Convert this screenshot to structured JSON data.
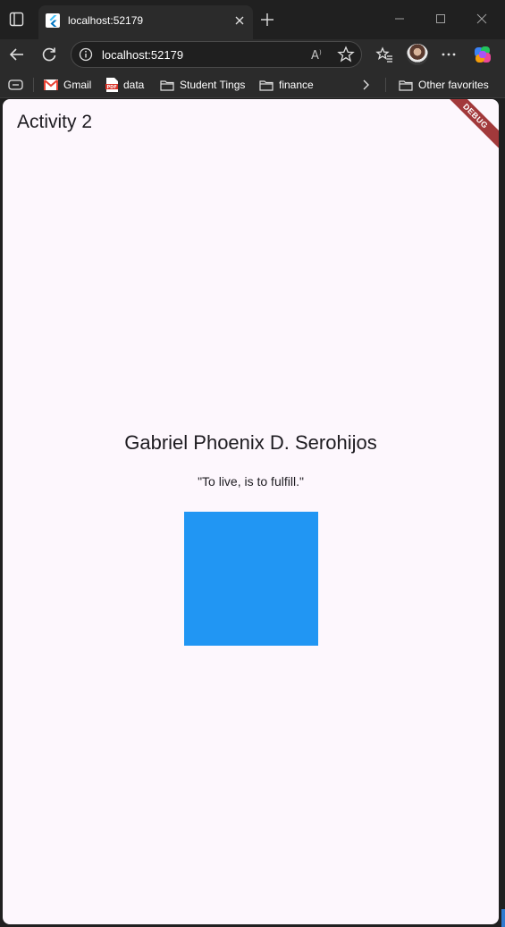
{
  "browser": {
    "tab": {
      "title": "localhost:52179"
    },
    "address": {
      "url": "localhost:52179"
    },
    "bookmarks": [
      {
        "label": "Gmail",
        "icon": "gmail-icon"
      },
      {
        "label": "data",
        "icon": "pdf-icon"
      },
      {
        "label": "Student Tings",
        "icon": "folder-icon"
      },
      {
        "label": "finance",
        "icon": "folder-icon"
      }
    ],
    "other_favorites": "Other favorites"
  },
  "app": {
    "appbar_title": "Activity 2",
    "debug_banner": "DEBUG",
    "name": "Gabriel Phoenix D. Serohijos",
    "quote": "\"To live, is to fulfill.\"",
    "square_color": "#2196f3"
  },
  "colors": {
    "page_background": "#fdf7fd",
    "chrome_background": "#202020",
    "toolbar_background": "#2b2b2b",
    "debug_banner": "#a2393b"
  }
}
